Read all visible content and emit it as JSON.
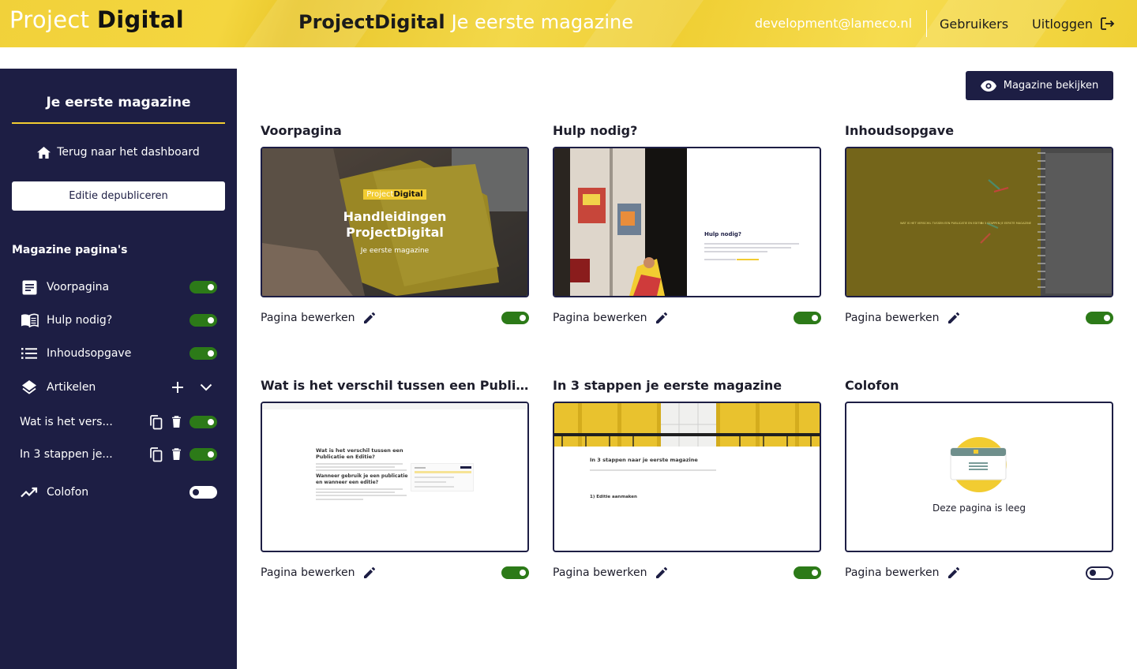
{
  "header": {
    "logo_light": "Project",
    "logo_bold": "Digital",
    "app_name": "ProjectDigital",
    "magazine_title": "Je eerste magazine",
    "email": "development@lameco.nl",
    "users_label": "Gebruikers",
    "logout_label": "Uitloggen"
  },
  "sidebar": {
    "title": "Je eerste magazine",
    "back_label": "Terug naar het dashboard",
    "unpublish_label": "Editie depubliceren",
    "section_title": "Magazine pagina's",
    "items": [
      {
        "label": "Voorpagina",
        "icon": "article-icon",
        "enabled": true
      },
      {
        "label": "Hulp nodig?",
        "icon": "open-book-icon",
        "enabled": true
      },
      {
        "label": "Inhoudsopgave",
        "icon": "list-icon",
        "enabled": true
      },
      {
        "label": "Artikelen",
        "icon": "layers-icon"
      }
    ],
    "articles": [
      {
        "label": "Wat is het vers...",
        "enabled": true
      },
      {
        "label": "In 3 stappen je...",
        "enabled": true
      }
    ],
    "colofon": {
      "label": "Colofon",
      "icon": "trend-icon",
      "enabled": false
    }
  },
  "main": {
    "view_button": "Magazine bekijken",
    "edit_label": "Pagina bewerken",
    "cards": [
      {
        "title": "Voorpagina",
        "enabled": true
      },
      {
        "title": "Hulp nodig?",
        "enabled": true
      },
      {
        "title": "Inhoudsopgave",
        "enabled": true
      },
      {
        "title": "Wat is het verschil tussen een Publicatie en Editie?",
        "enabled": true
      },
      {
        "title": "In 3 stappen je eerste magazine",
        "enabled": true
      },
      {
        "title": "Colofon",
        "enabled": false
      }
    ],
    "thumbs": {
      "cover_logo_light": "Project",
      "cover_logo_bold": "Digital",
      "cover_heading_1": "Handleidingen",
      "cover_heading_2": "ProjectDigital",
      "cover_sub": "Je eerste magazine",
      "help_heading": "Hulp nodig?",
      "toc_item_1": "WAT IS HET VERSCHIL TUSSEN EEN PUBLICATIE EN EDITIE",
      "toc_item_2": "IN 3 STAPPEN JE EERSTE MAGAZINE",
      "article1_heading": "Wat is het verschil tussen een Publicatie en Editie?",
      "article1_subheading": "Wanneer gebruik je een publicatie en wanneer een editie?",
      "article2_heading": "In 3 stappen naar je eerste magazine",
      "article2_step": "1) Editie aanmaken",
      "empty_text": "Deze pagina is leeg"
    }
  },
  "colors": {
    "brand_yellow": "#f2cc31",
    "navy": "#1d1e44",
    "toggle_on": "#2c7a18"
  }
}
